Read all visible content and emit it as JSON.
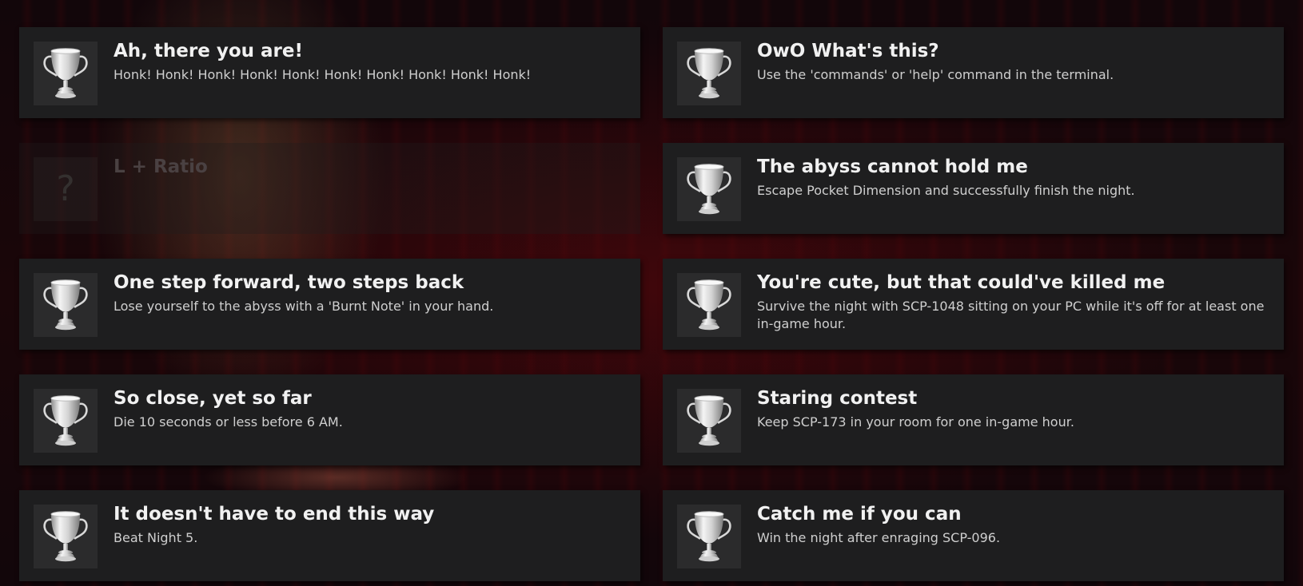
{
  "achievements": [
    {
      "title": "Ah, there you are!",
      "description": "Honk! Honk! Honk! Honk! Honk! Honk! Honk! Honk! Honk! Honk!",
      "icon": "trophy-icon",
      "locked": false
    },
    {
      "title": "OwO What's this?",
      "description": "Use the 'commands' or 'help' command in the terminal.",
      "icon": "trophy-icon",
      "locked": false
    },
    {
      "title": "L + Ratio",
      "description": "",
      "icon": "question-mark-icon",
      "locked": true,
      "icon_text": "?"
    },
    {
      "title": "The abyss cannot hold me",
      "description": "Escape Pocket Dimension and successfully finish the night.",
      "icon": "trophy-icon",
      "locked": false
    },
    {
      "title": "One step forward, two steps back",
      "description": "Lose yourself to the abyss with a 'Burnt Note' in your hand.",
      "icon": "trophy-icon",
      "locked": false
    },
    {
      "title": "You're cute, but that could've killed me",
      "description": "Survive the night with SCP-1048 sitting on your PC while it's off for at least one in-game hour.",
      "icon": "trophy-icon",
      "locked": false
    },
    {
      "title": "So close, yet so far",
      "description": "Die 10 seconds or less before 6 AM.",
      "icon": "trophy-icon",
      "locked": false
    },
    {
      "title": "Staring contest",
      "description": "Keep SCP-173 in your room for one in-game hour.",
      "icon": "trophy-icon",
      "locked": false
    },
    {
      "title": "It doesn't have to end this way",
      "description": "Beat Night 5.",
      "icon": "trophy-icon",
      "locked": false
    },
    {
      "title": "Catch me if you can",
      "description": "Win the night after enraging SCP-096.",
      "icon": "trophy-icon",
      "locked": false
    }
  ],
  "colors": {
    "card_background": "#1e1e1f",
    "title_text": "#f1f1f1",
    "description_text": "#cfcfcf",
    "locked_text": "#4a4142",
    "page_background": "#1a0609"
  }
}
